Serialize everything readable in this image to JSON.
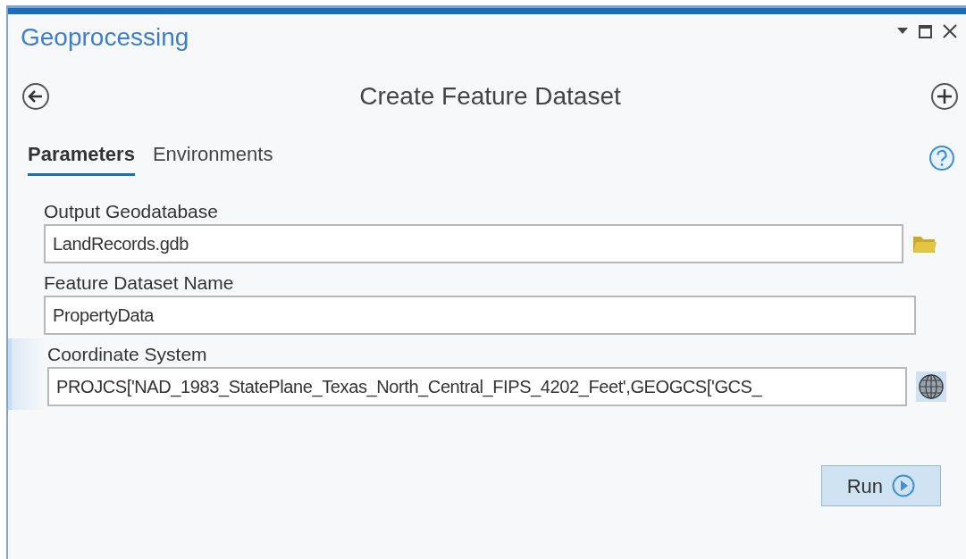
{
  "pane": {
    "title": "Geoprocessing"
  },
  "tool": {
    "title": "Create Feature Dataset"
  },
  "tabs": [
    {
      "label": "Parameters",
      "selected": true
    },
    {
      "label": "Environments",
      "selected": false
    }
  ],
  "parameters": [
    {
      "label": "Output Geodatabase",
      "value": "LandRecords.gdb",
      "kind": "folder",
      "active": false
    },
    {
      "label": "Feature Dataset Name",
      "value": "PropertyData",
      "kind": "text",
      "active": false
    },
    {
      "label": "Coordinate System",
      "value": "PROJCS['NAD_1983_StatePlane_Texas_North_Central_FIPS_4202_Feet',GEOGCS['GCS_",
      "kind": "globe",
      "active": true
    }
  ],
  "run_button": {
    "label": "Run"
  }
}
